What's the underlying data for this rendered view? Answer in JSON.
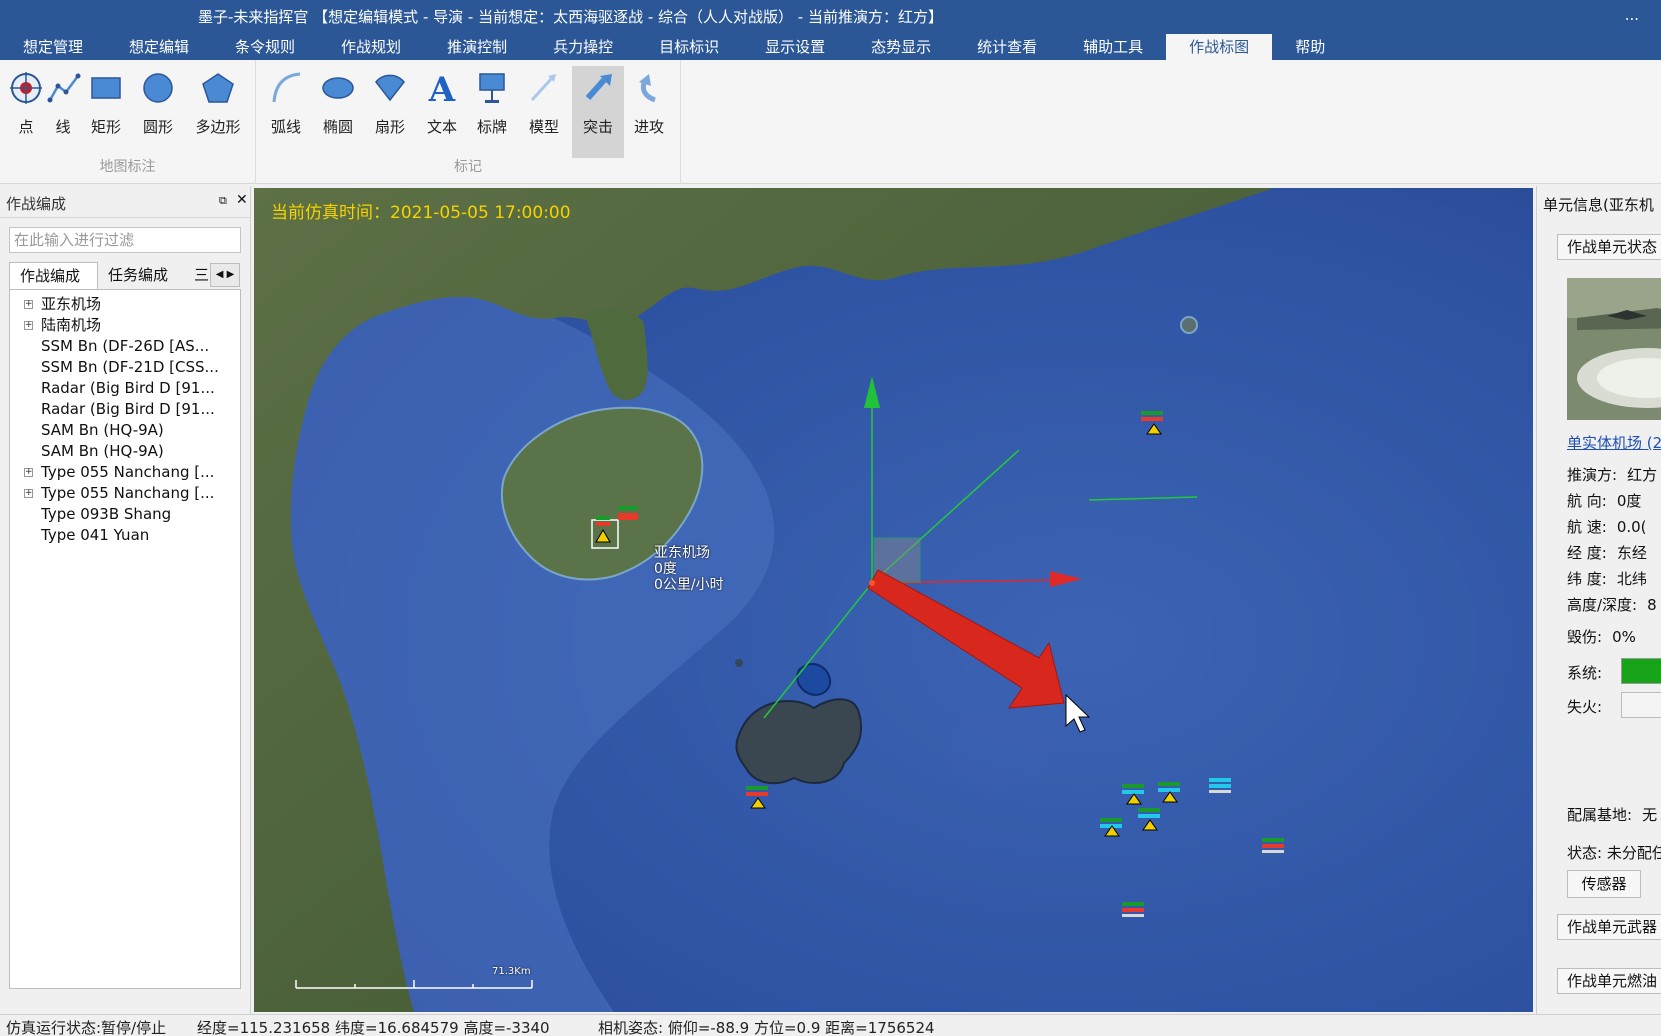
{
  "window": {
    "title": "墨子-未来指挥官 【想定编辑模式 - 导演 -  当前想定：太西海驱逐战 - 综合（人人对战版） -  当前推演方：红方】",
    "more": "..."
  },
  "menu": [
    "想定管理",
    "想定编辑",
    "条令规则",
    "作战规划",
    "推演控制",
    "兵力操控",
    "目标标识",
    "显示设置",
    "态势显示",
    "统计查看",
    "辅助工具",
    "作战标图",
    "帮助"
  ],
  "menu_active": "作战标图",
  "ribbon": {
    "group1": {
      "label": "地图标注",
      "buttons": [
        {
          "label": "点",
          "icon": "point-icon"
        },
        {
          "label": "线",
          "icon": "polyline-icon"
        },
        {
          "label": "矩形",
          "icon": "rectangle-icon"
        },
        {
          "label": "圆形",
          "icon": "circle-icon"
        },
        {
          "label": "多边形",
          "icon": "polygon-icon"
        }
      ]
    },
    "group2": {
      "label": "标记",
      "buttons": [
        {
          "label": "弧线",
          "icon": "arc-icon"
        },
        {
          "label": "椭圆",
          "icon": "ellipse-icon"
        },
        {
          "label": "扇形",
          "icon": "sector-icon"
        },
        {
          "label": "文本",
          "icon": "text-icon"
        },
        {
          "label": "标牌",
          "icon": "signboard-icon"
        },
        {
          "label": "模型",
          "icon": "model-icon"
        },
        {
          "label": "突击",
          "icon": "assault-icon",
          "active": true
        },
        {
          "label": "进攻",
          "icon": "attack-icon"
        }
      ]
    }
  },
  "left_panel": {
    "title": "作战编成",
    "filter_placeholder": "在此输入进行过滤",
    "tabs": [
      "作战编成",
      "任务编成",
      "三"
    ],
    "tree": [
      {
        "label": "亚东机场",
        "expandable": true
      },
      {
        "label": "陆南机场",
        "expandable": true
      },
      {
        "label": "SSM Bn (DF-26D [AS...",
        "expandable": false
      },
      {
        "label": "SSM Bn (DF-21D [CSS...",
        "expandable": false
      },
      {
        "label": "Radar (Big Bird D [91...",
        "expandable": false
      },
      {
        "label": "Radar (Big Bird D [91...",
        "expandable": false
      },
      {
        "label": "SAM Bn (HQ-9A)",
        "expandable": false
      },
      {
        "label": "SAM Bn (HQ-9A)",
        "expandable": false
      },
      {
        "label": "Type 055 Nanchang [...",
        "expandable": true
      },
      {
        "label": "Type 055 Nanchang [...",
        "expandable": true
      },
      {
        "label": "Type 093B Shang",
        "expandable": false
      },
      {
        "label": "Type 041 Yuan",
        "expandable": false
      }
    ]
  },
  "map": {
    "sim_time": "当前仿真时间：2021-05-05 17:00:00",
    "unit_label": {
      "name": "亚东机场",
      "heading": "0度",
      "speed": "0公里/小时"
    },
    "scale_text": "71.3Km"
  },
  "right_panel": {
    "title": "单元信息(亚东机",
    "status_section": "作战单元状态",
    "link": "单实体机场 (2",
    "side_label": "推演方:",
    "side_value": "红方",
    "heading_label": "航    向:",
    "heading_value": "0度",
    "speed_label": "航    速:",
    "speed_value": "0.0(",
    "lon_label": "经    度:",
    "lon_value": "东经",
    "lat_label": "纬    度:",
    "lat_value": "北纬",
    "alt_label": "高度/深度:",
    "alt_value": "8",
    "damage_label": "毁伤:",
    "damage_value": "0%",
    "system_label": "系统:",
    "fire_label": "失火:",
    "base_label": "配属基地:",
    "base_value": "无",
    "state_label": "状态: 未分配任",
    "sensor_btn": "传感器",
    "weapons_section": "作战单元武器",
    "fuel_section": "作战单元燃油"
  },
  "status_bar": {
    "run_state": "仿真运行状态:暂停/停止",
    "coords": "经度=115.231658  纬度=16.684579  高度=-3340",
    "camera": "相机姿态:  俯仰=-88.9  方位=0.9  距离=1756524"
  }
}
